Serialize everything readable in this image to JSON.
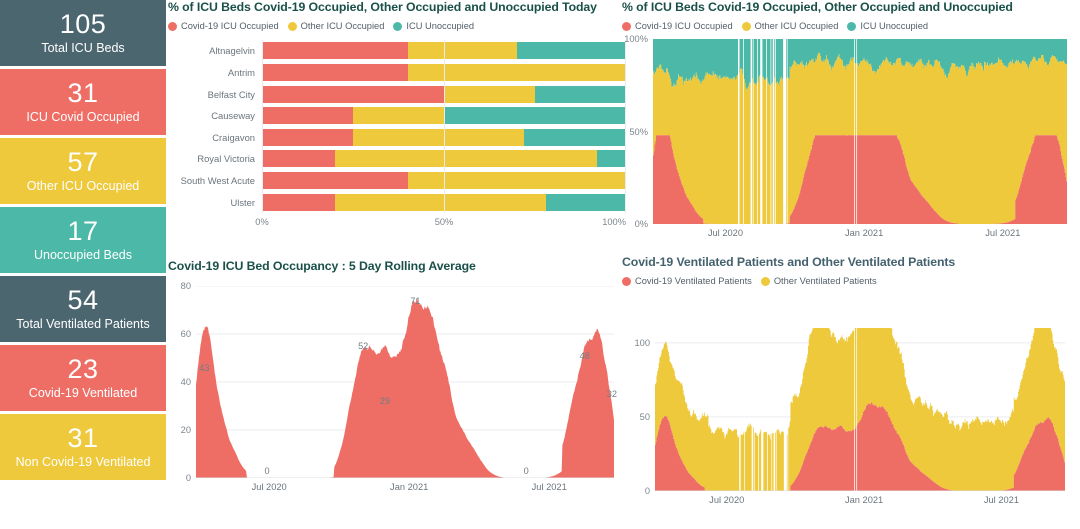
{
  "colors": {
    "covid_red": "#EE6E66",
    "other_yellow": "#EEC93C",
    "unoccupied_teal": "#4CB9A8",
    "slate": "#4C6670",
    "title_green": "#1A5049",
    "title_slate": "#44616E",
    "axis_text": "#6b757d",
    "gridline": "#eceef0"
  },
  "kpi_cards": [
    {
      "value": "105",
      "label": "Total ICU Beds",
      "color": "#4C6670",
      "name": "total-icu-beds"
    },
    {
      "value": "31",
      "label": "ICU Covid Occupied",
      "color": "#EE6E66",
      "name": "icu-covid-occupied"
    },
    {
      "value": "57",
      "label": "Other ICU Occupied",
      "color": "#EEC93C",
      "name": "other-icu-occupied"
    },
    {
      "value": "17",
      "label": "Unoccupied Beds",
      "color": "#4CB9A8",
      "name": "unoccupied-beds"
    },
    {
      "value": "54",
      "label": "Total Ventilated Patients",
      "color": "#4C6670",
      "name": "total-ventilated-patients"
    },
    {
      "value": "23",
      "label": "Covid-19 Ventilated",
      "color": "#EE6E66",
      "name": "covid-19-ventilated"
    },
    {
      "value": "31",
      "label": "Non Covid-19 Ventilated",
      "color": "#EEC93C",
      "name": "non-covid-19-ventilated"
    }
  ],
  "chart_data": [
    {
      "id": "icu_beds_today",
      "type": "bar",
      "orientation": "horizontal",
      "stacked": "percent",
      "title": "% of ICU Beds Covid-19 Occupied, Other Occupied and Unoccupied Today",
      "xlabel": "",
      "ylabel": "",
      "xlim": [
        0,
        100
      ],
      "xticks": [
        "0%",
        "50%",
        "100%"
      ],
      "xtick_values": [
        0,
        50,
        100
      ],
      "grid": true,
      "legend_position": "top-left",
      "legend": [
        "Covid-19 ICU Occupied",
        "Other ICU Occupied",
        "ICU Unoccupied"
      ],
      "categories": [
        "Altnagelvin",
        "Antrim",
        "Belfast City",
        "Causeway",
        "Craigavon",
        "Royal Victoria",
        "South West Acute",
        "Ulster"
      ],
      "series": [
        {
          "name": "Covid-19 ICU Occupied",
          "color": "#EE6E66",
          "values": [
            40,
            40,
            50,
            25,
            25,
            20,
            40,
            20
          ]
        },
        {
          "name": "Other ICU Occupied",
          "color": "#EEC93C",
          "values": [
            30,
            60,
            25,
            25,
            47,
            72,
            60,
            58
          ]
        },
        {
          "name": "ICU Unoccupied",
          "color": "#4CB9A8",
          "values": [
            30,
            0,
            25,
            50,
            28,
            8,
            0,
            22
          ]
        }
      ]
    },
    {
      "id": "icu_beds_timeseries",
      "type": "area",
      "stacked": "percent",
      "title": "% of ICU Beds Covid-19 Occupied, Other Occupied and Unoccupied",
      "xlabel": "",
      "ylabel": "",
      "ylim": [
        0,
        100
      ],
      "yticks": [
        "0%",
        "50%",
        "100%"
      ],
      "ytick_values": [
        0,
        50,
        100
      ],
      "xticks": [
        "Jul 2020",
        "Jan 2021",
        "Jul 2021"
      ],
      "grid": false,
      "legend_position": "top-left",
      "legend": [
        "Covid-19 ICU Occupied",
        "Other ICU Occupied",
        "ICU Unoccupied"
      ],
      "note": "Daily 100% stacked columns Apr 2020 - Oct 2021; white vertical gaps indicate missing data in mid-2020.",
      "series": [
        {
          "name": "Covid-19 ICU Occupied",
          "color": "#EE6E66"
        },
        {
          "name": "Other ICU Occupied",
          "color": "#EEC93C"
        },
        {
          "name": "ICU Unoccupied",
          "color": "#4CB9A8"
        }
      ]
    },
    {
      "id": "covid_icu_rolling",
      "type": "area",
      "title": "Covid-19 ICU Bed Occupancy : 5 Day Rolling Average",
      "xlabel": "",
      "ylabel": "",
      "ylim": [
        0,
        80
      ],
      "yticks": [
        "0",
        "20",
        "40",
        "60",
        "80"
      ],
      "ytick_values": [
        0,
        20,
        40,
        60,
        80
      ],
      "xticks": [
        "Jul 2020",
        "Jan 2021",
        "Jul 2021"
      ],
      "grid": true,
      "legend_position": "none",
      "series": [
        {
          "name": "Covid-19 ICU Beds",
          "color": "#EE6E66"
        }
      ],
      "annotations": [
        {
          "label": "43",
          "value": 43
        },
        {
          "label": "0",
          "value": 0
        },
        {
          "label": "52",
          "value": 52
        },
        {
          "label": "29",
          "value": 29
        },
        {
          "label": "71",
          "value": 71
        },
        {
          "label": "0",
          "value": 0
        },
        {
          "label": "48",
          "value": 48
        },
        {
          "label": "32",
          "value": 32
        }
      ]
    },
    {
      "id": "ventilated_patients",
      "type": "area",
      "stacked": "true",
      "title": "Covid-19 Ventilated Patients and Other Ventilated Patients",
      "xlabel": "",
      "ylabel": "",
      "ylim": [
        0,
        110
      ],
      "yticks": [
        "0",
        "50",
        "100"
      ],
      "ytick_values": [
        0,
        50,
        100
      ],
      "xticks": [
        "Jul 2020",
        "Jan 2021",
        "Jul 2021"
      ],
      "grid": true,
      "legend_position": "top-left",
      "legend": [
        "Covid-19 Ventilated Patients",
        "Other Ventilated Patients"
      ],
      "series": [
        {
          "name": "Covid-19 Ventilated Patients",
          "color": "#EE6E66"
        },
        {
          "name": "Other Ventilated Patients",
          "color": "#EEC93C"
        }
      ]
    }
  ]
}
